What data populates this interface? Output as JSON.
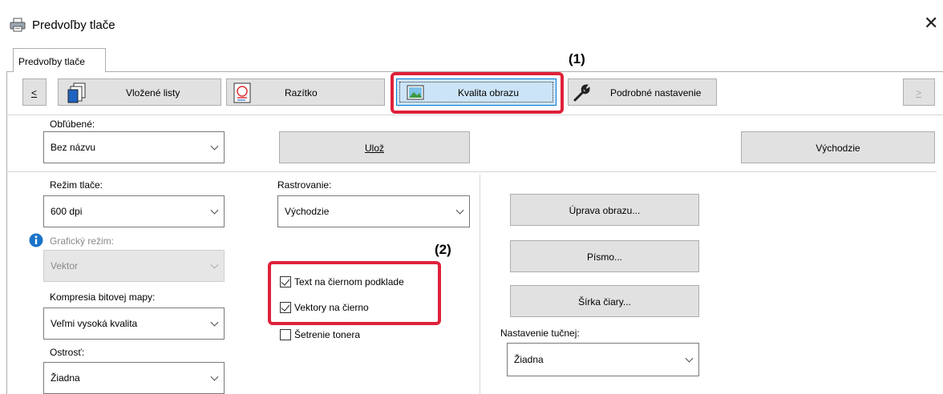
{
  "window": {
    "title": "Predvoľby tlače",
    "tab_label": "Predvoľby tlače",
    "close_glyph": "✕"
  },
  "nav": {
    "prev_glyph": "<",
    "next_glyph": ">",
    "items": [
      {
        "label": "Vložené listy",
        "icon": "inserted-sheets-icon"
      },
      {
        "label": "Razítko",
        "icon": "stamp-icon"
      },
      {
        "label": "Kvalita obrazu",
        "icon": "image-quality-icon",
        "selected": true
      },
      {
        "label": "Podrobné nastavenie",
        "icon": "wrench-icon"
      }
    ]
  },
  "favorites": {
    "label": "Obľúbené:",
    "value": "Bez názvu",
    "save_label": "Ulož",
    "defaults_label": "Východzie"
  },
  "print_mode": {
    "label": "Režim tlače:",
    "value": "600 dpi"
  },
  "graphics_mode": {
    "label": "Grafický režim:",
    "value": "Vektor",
    "enabled": false
  },
  "bitmap_compression": {
    "label": "Kompresia bitovej mapy:",
    "value": "Veľmi vysoká kvalita"
  },
  "sharpness": {
    "label": "Ostrosť:",
    "value": "Žiadna"
  },
  "screening": {
    "label": "Rastrovanie:",
    "value": "Východzie"
  },
  "checkboxes": [
    {
      "label": "Text na čiernom podklade",
      "checked": true
    },
    {
      "label": "Vektory na čierno",
      "checked": true
    },
    {
      "label": "Šetrenie tonera",
      "checked": false
    }
  ],
  "right_buttons": {
    "image_adjust": "Úprava obrazu...",
    "font": "Písmo...",
    "line_width": "Šírka čiary..."
  },
  "bold_setting": {
    "label": "Nastavenie tučnej:",
    "value": "Žiadna"
  },
  "callouts": {
    "one": "(1)",
    "two": "(2)"
  },
  "colors": {
    "highlight": "#e0213a",
    "selected_tab_bg": "#cce4f7",
    "selected_tab_border": "#0078d7",
    "info_icon": "#1a73c8"
  }
}
